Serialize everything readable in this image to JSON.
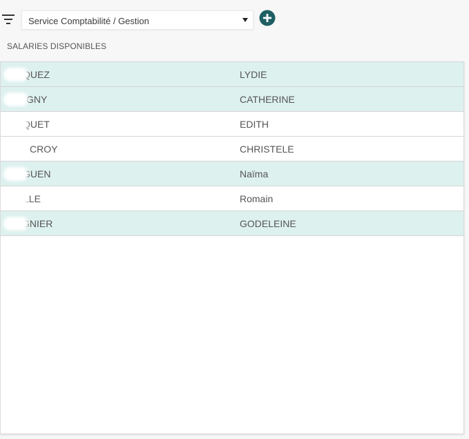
{
  "toolbar": {
    "filter_icon": "filter-icon",
    "service_select": {
      "selected": "Service Comptabilité / Gestion",
      "caret_icon": "caret-down-icon"
    },
    "add_icon": "add-circle-icon",
    "accent_color": "#1f5f63"
  },
  "section": {
    "title": "SALARIES DISPONIBLES"
  },
  "employees": [
    {
      "last_name": "QUEZ",
      "first_name": "LYDIE",
      "highlighted": true
    },
    {
      "last_name": "GNY",
      "first_name": "CATHERINE",
      "highlighted": true
    },
    {
      "last_name": "QUET",
      "first_name": "EDITH",
      "highlighted": false
    },
    {
      "last_name": "CROY",
      "first_name": "CHRISTELE",
      "highlighted": false
    },
    {
      "last_name": "GUEN",
      "first_name": "Naïma",
      "highlighted": true
    },
    {
      "last_name": "LLE",
      "first_name": "Romain",
      "highlighted": false
    },
    {
      "last_name": "GNIER",
      "first_name": "GODELEINE",
      "highlighted": true
    }
  ],
  "colors": {
    "highlight_row": "#ddf1ee",
    "text": "#555555"
  }
}
